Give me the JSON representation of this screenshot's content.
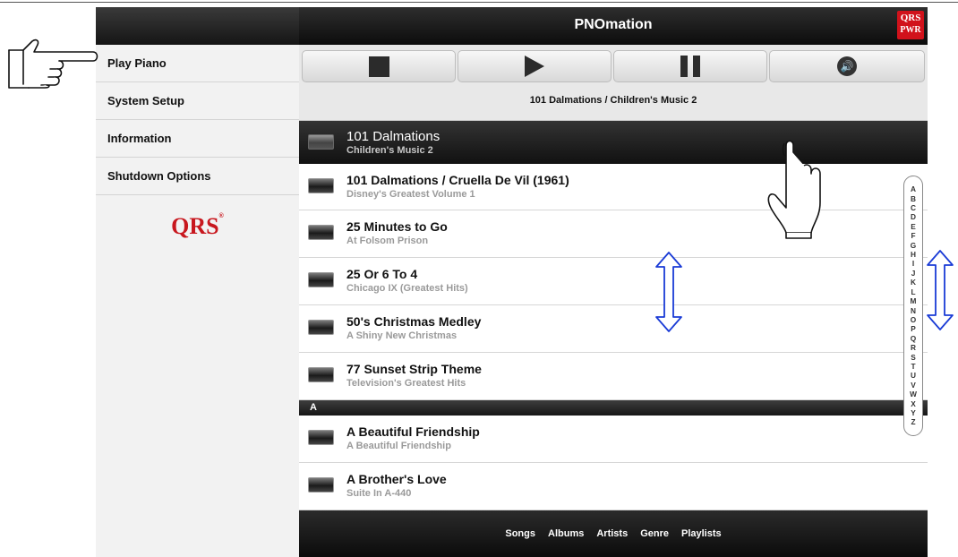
{
  "app": {
    "title": "PNOmation",
    "badge_top": "QRS",
    "badge_bottom": "PWR"
  },
  "sidebar": {
    "items": [
      {
        "label": "Play Piano"
      },
      {
        "label": "System Setup"
      },
      {
        "label": "Information"
      },
      {
        "label": "Shutdown Options"
      }
    ],
    "logo": "QRS",
    "logo_mark": "®"
  },
  "controls": {
    "stop_icon": "stop-icon",
    "play_icon": "play-icon",
    "pause_icon": "pause-icon",
    "volume_icon": "volume-icon",
    "volume_glyph": "🔊"
  },
  "now_playing": "101 Dalmations / Children's Music 2",
  "selected": {
    "title": "101 Dalmations",
    "subtitle": "Children's Music 2"
  },
  "songs": [
    {
      "title": "101 Dalmations / Cruella De Vil (1961)",
      "subtitle": "Disney's Greatest Volume 1"
    },
    {
      "title": "25 Minutes to Go",
      "subtitle": "At Folsom Prison"
    },
    {
      "title": "25 Or 6 To 4",
      "subtitle": "Chicago IX (Greatest Hits)"
    },
    {
      "title": "50's Christmas Medley",
      "subtitle": "A Shiny New Christmas"
    },
    {
      "title": "77 Sunset Strip Theme",
      "subtitle": "Television's Greatest Hits"
    }
  ],
  "section_header": "A",
  "songs_a": [
    {
      "title": "A Beautiful Friendship",
      "subtitle": "A Beautiful Friendship"
    },
    {
      "title": "A Brother's Love",
      "subtitle": "Suite In A-440"
    }
  ],
  "alphabet": [
    "A",
    "B",
    "C",
    "D",
    "E",
    "F",
    "G",
    "H",
    "I",
    "J",
    "K",
    "L",
    "M",
    "N",
    "O",
    "P",
    "Q",
    "R",
    "S",
    "T",
    "U",
    "V",
    "W",
    "X",
    "Y",
    "Z"
  ],
  "bottom_tabs": [
    "Songs",
    "Albums",
    "Artists",
    "Genre",
    "Playlists"
  ],
  "colors": {
    "accent": "#c8171e",
    "annotation_arrow": "#1a3bd6"
  }
}
